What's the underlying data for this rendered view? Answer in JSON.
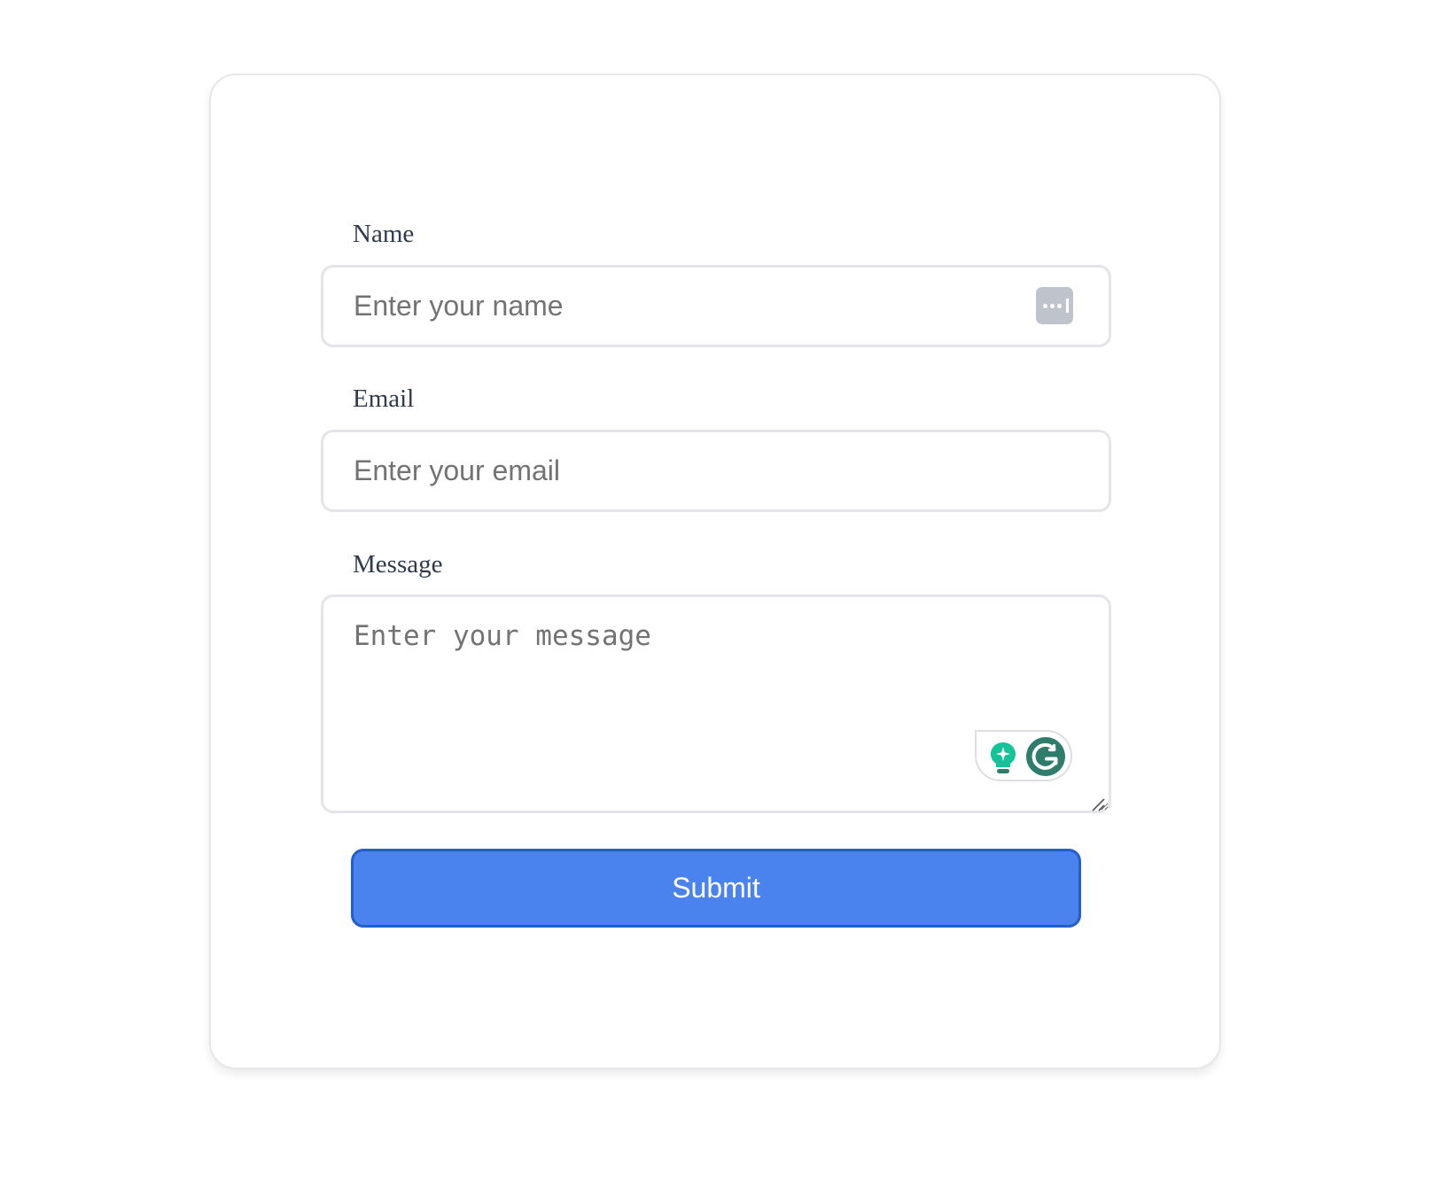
{
  "form": {
    "fields": {
      "name": {
        "label": "Name",
        "placeholder": "Enter your name",
        "value": ""
      },
      "email": {
        "label": "Email",
        "placeholder": "Enter your email",
        "value": ""
      },
      "message": {
        "label": "Message",
        "placeholder": "Enter your message",
        "value": ""
      }
    },
    "submit_label": "Submit"
  },
  "overlays": {
    "name_field_icon": "password-manager-icon",
    "grammarly_icons": [
      "lightbulb-sparkle-icon",
      "grammarly-g-icon"
    ]
  },
  "colors": {
    "submit_background": "#4a83ed",
    "submit_border": "#245ecb",
    "label_text": "#2f3a4d",
    "placeholder_text": "#737373",
    "field_border": "#e4e5e8",
    "grammarly_green": "#15c39a",
    "grammarly_dark_green": "#2e7c6c"
  }
}
